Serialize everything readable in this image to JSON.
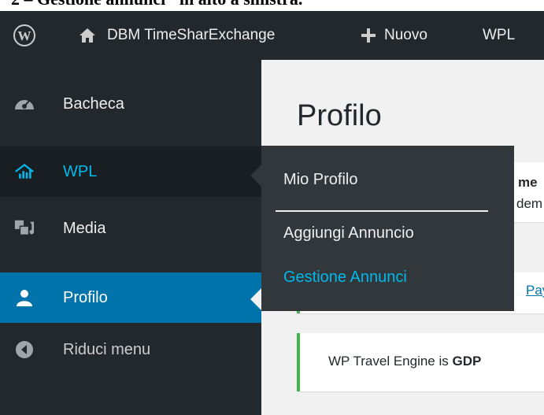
{
  "caption": {
    "text": "2 – Gestione annunci\" in alto a sinistra."
  },
  "admin_bar": {
    "site_name": "DBM TimeSharExchange",
    "new_label": "Nuovo",
    "plugin_label": "WPL"
  },
  "sidebar": {
    "items": [
      {
        "label": "Bacheca",
        "icon": "dashboard-icon"
      },
      {
        "label": "WPL",
        "icon": "wpl-house-icon",
        "state": "hover"
      },
      {
        "label": "Media",
        "icon": "media-icon"
      },
      {
        "label": "Profilo",
        "icon": "user-icon",
        "state": "current"
      },
      {
        "label": "Riduci menu",
        "icon": "collapse-icon"
      }
    ]
  },
  "flyout": {
    "items": [
      {
        "label": "Mio Profilo"
      },
      {
        "label": "Aggiungi Annuncio"
      },
      {
        "label": "Gestione Annunci",
        "state": "hover"
      }
    ]
  },
  "main": {
    "title": "Profilo",
    "notice1_partial": "me",
    "notice1_sub_partial": "dem",
    "notice2_link_partial": "Pay",
    "notice3_text": "WP Travel Engine is ",
    "notice3_bold": "GDP"
  },
  "colors": {
    "admin_bg": "#23282d",
    "wpl_active": "#00b9eb",
    "current_bg": "#0073aa",
    "flyout_bg": "#32373c",
    "notice_green": "#46b450",
    "link": "#0073aa"
  }
}
